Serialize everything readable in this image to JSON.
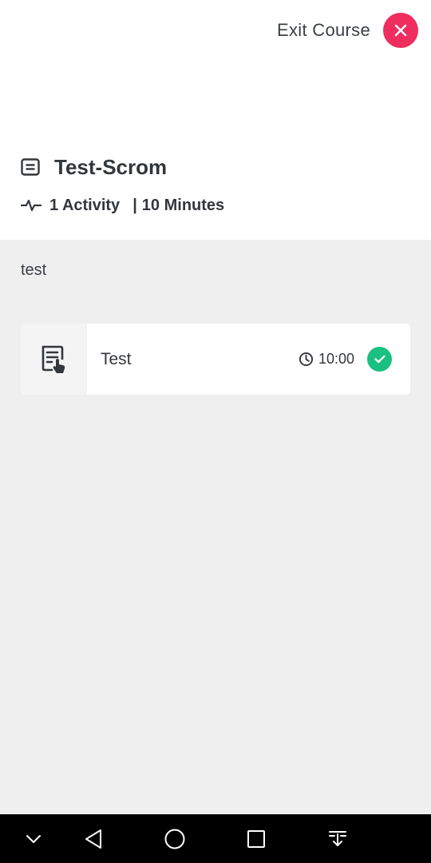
{
  "header": {
    "exit_label": "Exit Course",
    "course_title": "Test-Scrom",
    "activity_count": "1 Activity",
    "separator": "|",
    "duration": "10 Minutes"
  },
  "course": {
    "description": "test"
  },
  "activities": [
    {
      "name": "Test",
      "time": "10:00",
      "status": "completed"
    }
  ],
  "icons": {
    "exit": "close-icon",
    "course": "document-icon",
    "meta": "pulse-icon",
    "activity": "scorm-activity-icon",
    "time": "clock-icon",
    "status": "check-icon"
  },
  "colors": {
    "exit_button": "#ef2d5e",
    "completed": "#19c07f",
    "text": "#33363b",
    "body_bg": "#efefef"
  },
  "navbar": {
    "buttons": [
      "chevron-down-icon",
      "back-icon",
      "home-icon",
      "recents-icon",
      "notifications-pull-icon"
    ]
  }
}
